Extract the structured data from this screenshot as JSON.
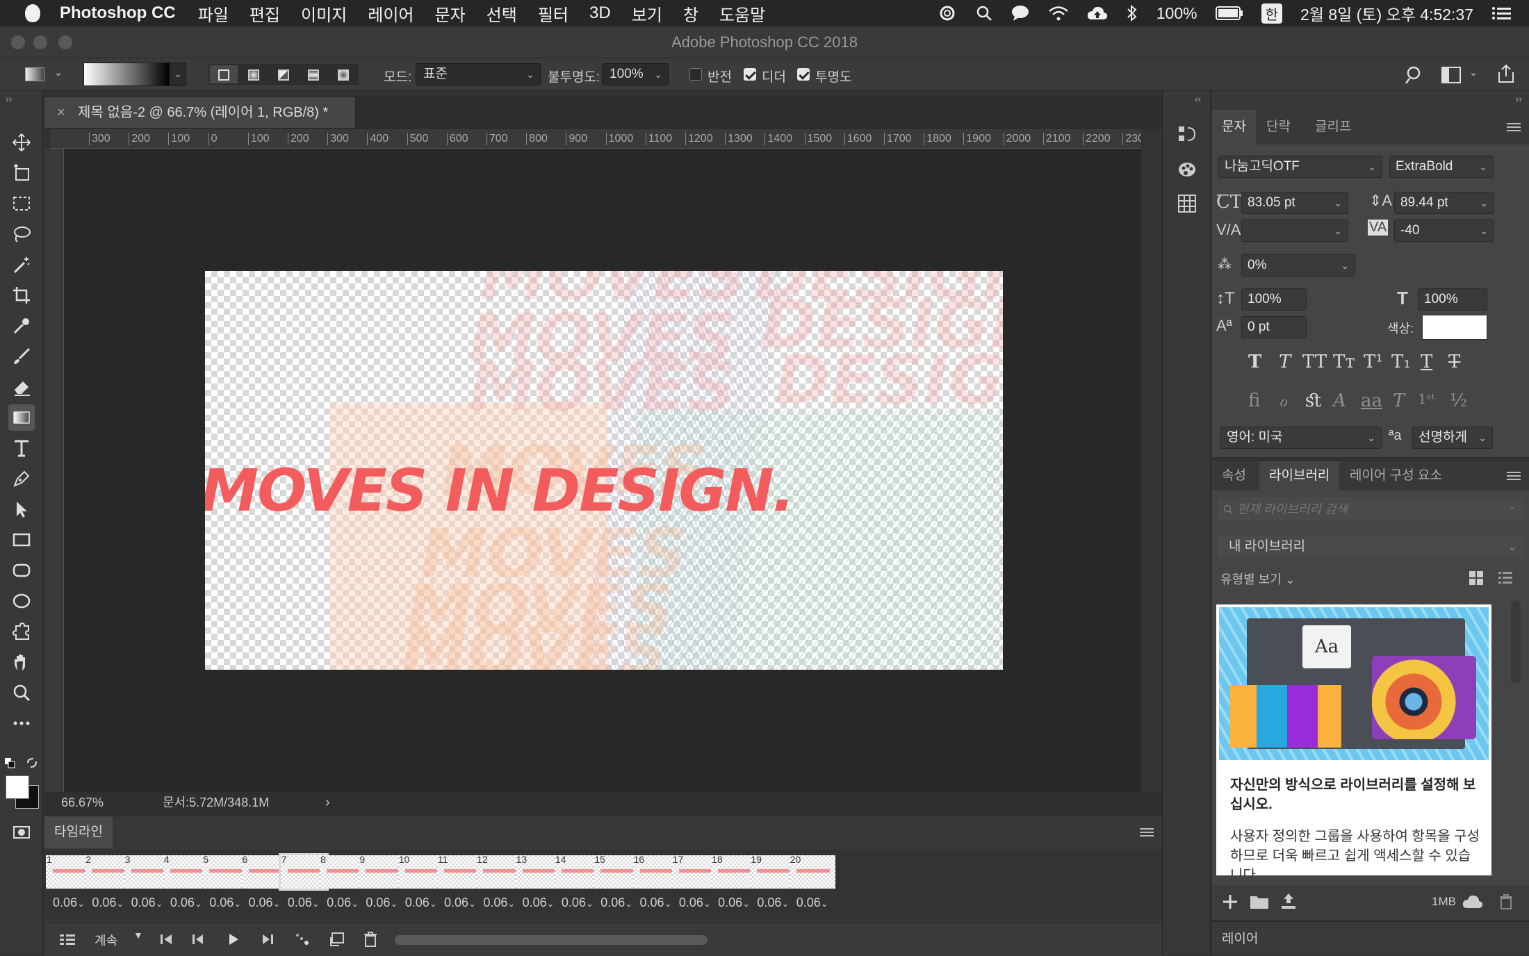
{
  "menubar": {
    "app_name": "Photoshop CC",
    "items": [
      "파일",
      "편집",
      "이미지",
      "레이어",
      "문자",
      "선택",
      "필터",
      "3D",
      "보기",
      "창",
      "도움말"
    ],
    "battery": "100%",
    "input_method": "한",
    "datetime": "2월 8일 (토) 오후 4:52:37"
  },
  "window": {
    "title": "Adobe Photoshop CC 2018"
  },
  "options": {
    "mode_label": "모드:",
    "mode_value": "표준",
    "opacity_label": "불투명도:",
    "opacity_value": "100%",
    "reverse_label": "반전",
    "reverse_checked": false,
    "dither_label": "디더",
    "dither_checked": true,
    "transparency_label": "투명도",
    "transparency_checked": true
  },
  "document": {
    "tab_title": "제목 없음-2 @ 66.7% (레이어 1, RGB/8) *",
    "ruler_ticks": [
      "300",
      "200",
      "100",
      "0",
      "100",
      "200",
      "300",
      "400",
      "500",
      "600",
      "700",
      "800",
      "900",
      "1000",
      "1100",
      "1200",
      "1300",
      "1400",
      "1500",
      "1600",
      "1700",
      "1800",
      "1900",
      "2000",
      "2100",
      "2200",
      "230"
    ],
    "artwork_text": "MOVES IN DESIGN.",
    "bg_word_1": "MOVES",
    "bg_word_2": "DESIGN",
    "accent_color": "#f25c5c"
  },
  "status": {
    "zoom": "66.67%",
    "doc_size": "문서:5.72M/348.1M"
  },
  "timeline": {
    "tab_label": "타임라인",
    "frames": [
      {
        "n": "1",
        "d": "0.06"
      },
      {
        "n": "2",
        "d": "0.06"
      },
      {
        "n": "3",
        "d": "0.06"
      },
      {
        "n": "4",
        "d": "0.06"
      },
      {
        "n": "5",
        "d": "0.06"
      },
      {
        "n": "6",
        "d": "0.06"
      },
      {
        "n": "7",
        "d": "0.06"
      },
      {
        "n": "8",
        "d": "0.06"
      },
      {
        "n": "9",
        "d": "0.06"
      },
      {
        "n": "10",
        "d": "0.06"
      },
      {
        "n": "11",
        "d": "0.06"
      },
      {
        "n": "12",
        "d": "0.06"
      },
      {
        "n": "13",
        "d": "0.06"
      },
      {
        "n": "14",
        "d": "0.06"
      },
      {
        "n": "15",
        "d": "0.06"
      },
      {
        "n": "16",
        "d": "0.06"
      },
      {
        "n": "17",
        "d": "0.06"
      },
      {
        "n": "18",
        "d": "0.06"
      },
      {
        "n": "19",
        "d": "0.06"
      },
      {
        "n": "20",
        "d": "0.06"
      }
    ],
    "selected_frame": "7",
    "loop_value": "계속"
  },
  "character_panel": {
    "tabs": [
      "문자",
      "단락",
      "글리프"
    ],
    "font_family": "나눔고딕OTF",
    "font_style": "ExtraBold",
    "font_size": "83.05 pt",
    "leading": "89.44 pt",
    "kerning": "",
    "tracking": "-40",
    "tsume": "0%",
    "vertical_scale": "100%",
    "horizontal_scale": "100%",
    "baseline_shift": "0 pt",
    "color_label": "색상:",
    "color_value": "#ffffff",
    "language": "영어: 미국",
    "aa_label": "ªa",
    "antialias": "선명하게"
  },
  "library_panel": {
    "tabs": [
      "속성",
      "라이브러리",
      "레이어 구성 요소"
    ],
    "search_placeholder": "현재 라이브러리 검색",
    "library_name": "내 라이브러리",
    "view_by": "유형별 보기",
    "card_icon_text": "Aa",
    "heading": "자신만의 방식으로 라이브러리를 설정해 보십시오.",
    "body": "사용자 정의한 그룹을 사용하여 항목을 구성하므로 더욱 빠르고 쉽게 액세스할 수 있습니다.",
    "storage": "1MB"
  },
  "layers_panel": {
    "title": "레이어"
  }
}
